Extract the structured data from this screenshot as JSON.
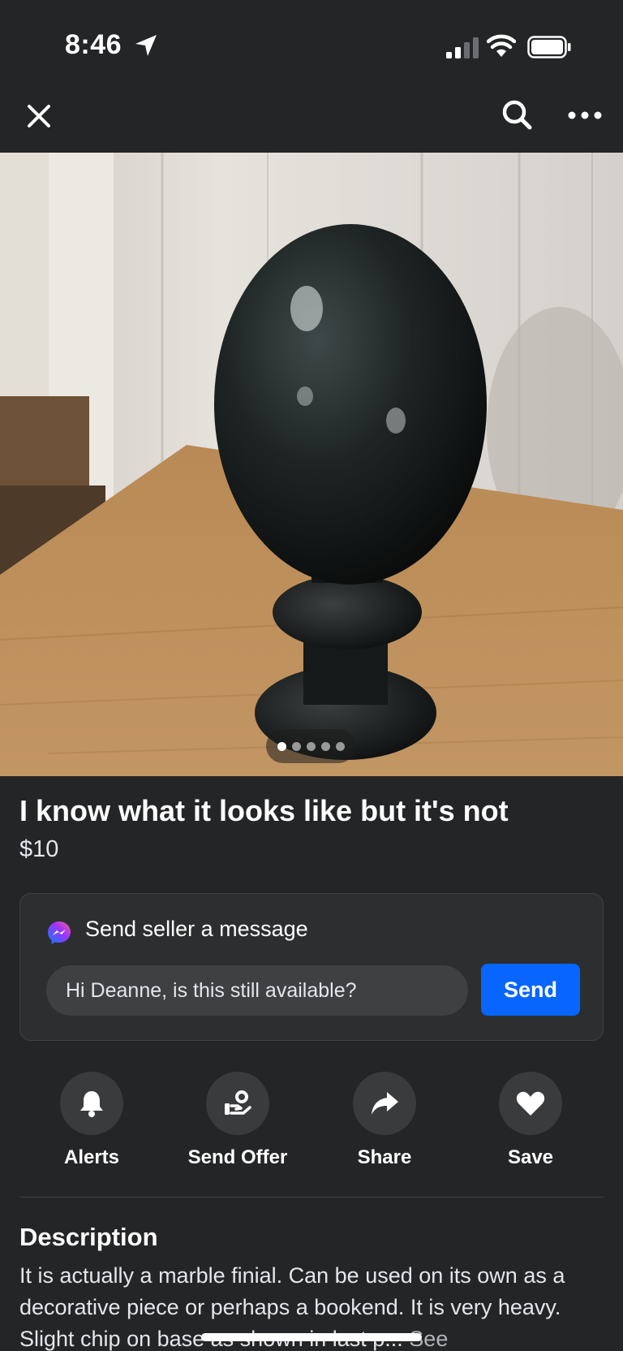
{
  "status_bar": {
    "time": "8:46",
    "icons": [
      "location-arrow-icon",
      "cellular-signal-icon",
      "wifi-icon",
      "battery-icon"
    ]
  },
  "nav": {
    "icons": [
      "close-icon",
      "search-icon",
      "more-icon"
    ]
  },
  "photo": {
    "carousel_total": 5,
    "carousel_active": 1
  },
  "listing": {
    "title": "I know what it looks like but it's not",
    "price": "$10"
  },
  "message_card": {
    "heading": "Send seller a message",
    "input_value": "Hi Deanne, is this still available?",
    "send_label": "Send",
    "icon": "messenger-icon"
  },
  "actions": [
    {
      "label": "Alerts",
      "icon": "bell-icon"
    },
    {
      "label": "Send Offer",
      "icon": "offer-icon"
    },
    {
      "label": "Share",
      "icon": "share-icon"
    },
    {
      "label": "Save",
      "icon": "heart-icon"
    }
  ],
  "description": {
    "heading": "Description",
    "text": "It is actually a marble finial. Can be used on its own as a decorative piece or perhaps a bookend. It is very heavy. Slight chip on base as shown in last p...",
    "see_more": "See"
  },
  "colors": {
    "background": "#242526",
    "accent": "#0866ff",
    "text": "#e4e6eb"
  }
}
